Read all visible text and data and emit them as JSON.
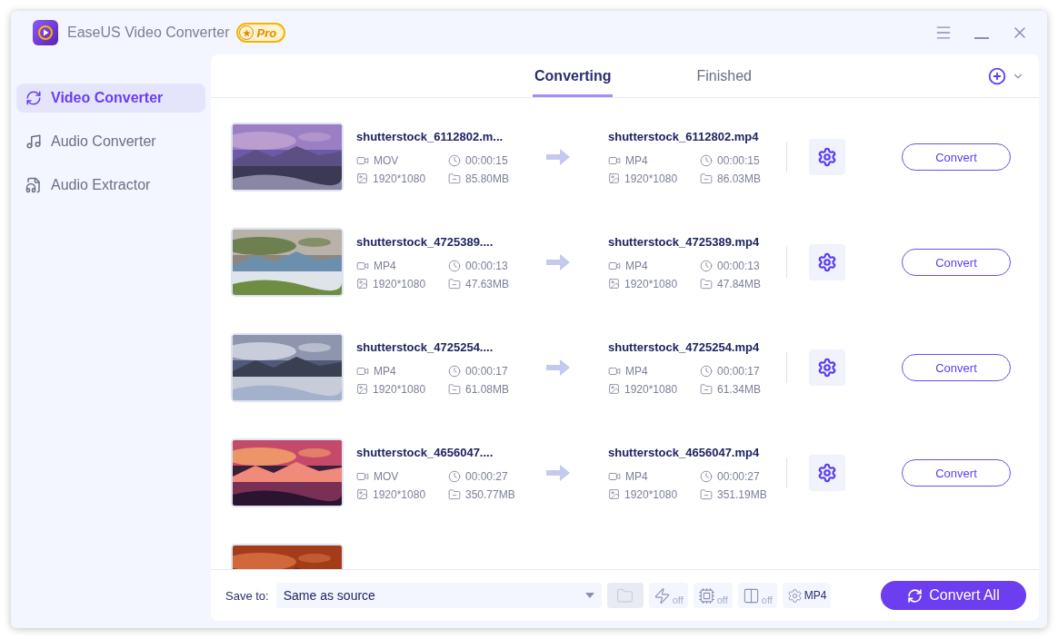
{
  "window": {
    "title": "EaseUS Video Converter",
    "badge": "Pro"
  },
  "sidebar": {
    "items": [
      {
        "label": "Video Converter",
        "kind": "video",
        "selected": true
      },
      {
        "label": "Audio Converter",
        "kind": "audio",
        "selected": false
      },
      {
        "label": "Audio Extractor",
        "kind": "extract",
        "selected": false
      }
    ]
  },
  "tabs": [
    {
      "label": "Converting",
      "selected": true
    },
    {
      "label": "Finished",
      "selected": false
    }
  ],
  "files": [
    {
      "source": {
        "name": "shutterstock_6112802.m...",
        "format": "MOV",
        "duration": "00:00:15",
        "resolution": "1920*1080",
        "size": "85.80MB"
      },
      "output": {
        "name": "shutterstock_6112802.mp4",
        "format": "MP4",
        "duration": "00:00:15",
        "resolution": "1920*1080",
        "size": "86.03MB"
      },
      "button": "Convert"
    },
    {
      "source": {
        "name": "shutterstock_4725389....",
        "format": "MP4",
        "duration": "00:00:13",
        "resolution": "1920*1080",
        "size": "47.63MB"
      },
      "output": {
        "name": "shutterstock_4725389.mp4",
        "format": "MP4",
        "duration": "00:00:13",
        "resolution": "1920*1080",
        "size": "47.84MB"
      },
      "button": "Convert"
    },
    {
      "source": {
        "name": "shutterstock_4725254....",
        "format": "MP4",
        "duration": "00:00:17",
        "resolution": "1920*1080",
        "size": "61.08MB"
      },
      "output": {
        "name": "shutterstock_4725254.mp4",
        "format": "MP4",
        "duration": "00:00:17",
        "resolution": "1920*1080",
        "size": "61.34MB"
      },
      "button": "Convert"
    },
    {
      "source": {
        "name": "shutterstock_4656047....",
        "format": "MOV",
        "duration": "00:00:27",
        "resolution": "1920*1080",
        "size": "350.77MB"
      },
      "output": {
        "name": "shutterstock_4656047.mp4",
        "format": "MP4",
        "duration": "00:00:27",
        "resolution": "1920*1080",
        "size": "351.19MB"
      },
      "button": "Convert"
    }
  ],
  "more_below": true,
  "save_to": {
    "label": "Save to:",
    "value": "Same as source"
  },
  "toggles": [
    {
      "kind": "folder",
      "disabled": true
    },
    {
      "kind": "speed",
      "label": "off",
      "disabled": false
    },
    {
      "kind": "gpu",
      "label": "off",
      "disabled": false
    },
    {
      "kind": "merge",
      "label": "off",
      "disabled": false
    },
    {
      "kind": "format",
      "label": "MP4",
      "disabled": false
    }
  ],
  "convert_all": "Convert All"
}
